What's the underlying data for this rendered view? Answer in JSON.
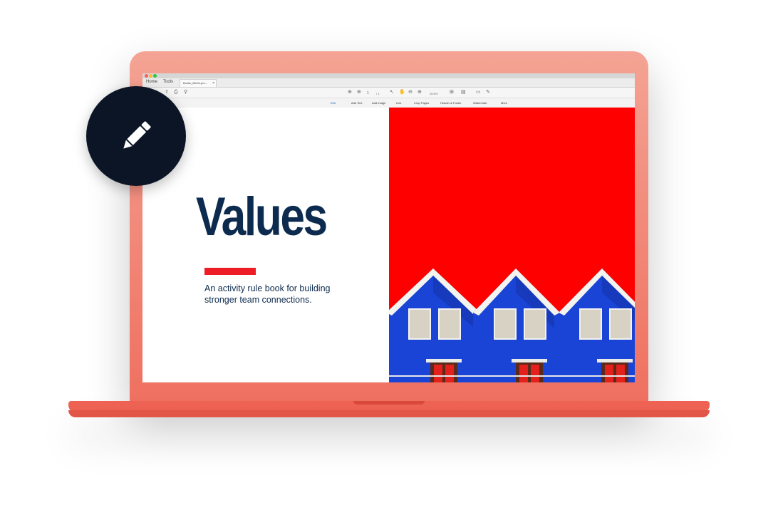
{
  "app": {
    "tabs": [
      "Home",
      "Tools"
    ],
    "document_tab": "Books_Briefs-pro...",
    "page_current": "1",
    "page_total": "/ 1",
    "zoom": "28.5%"
  },
  "edit_toolbar": {
    "items": [
      "Edit",
      "Add Text",
      "Add Image",
      "Link",
      "Crop Pages",
      "Header & Footer",
      "Watermark",
      "More"
    ]
  },
  "document": {
    "title": "Values",
    "subtitle": "An activity rule book for building stronger team connections."
  },
  "colors": {
    "laptop": "#ef6f60",
    "title": "#0d2b4e",
    "accent": "#ee1c25",
    "photo_background": "#ff0000",
    "house_blue": "#1a44d6",
    "badge": "#0b1526"
  },
  "badge": {
    "icon": "pencil-icon"
  }
}
